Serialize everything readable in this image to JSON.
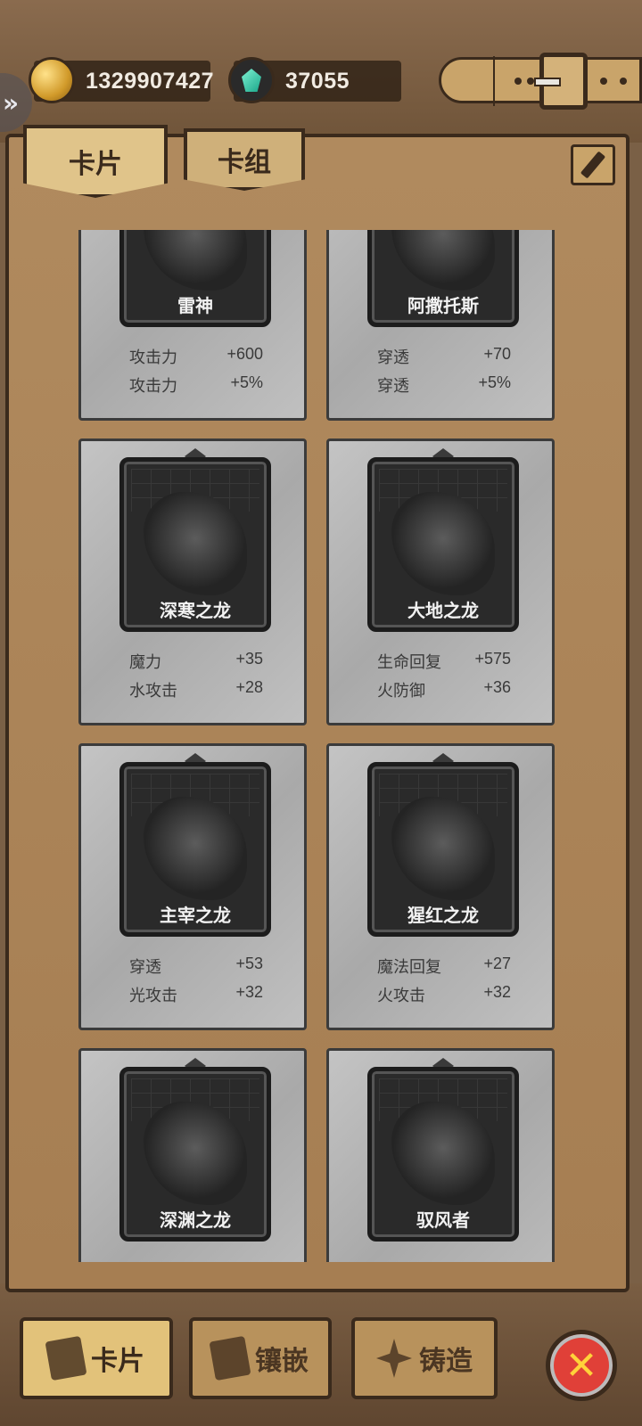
{
  "resources": {
    "gold": "1329907427",
    "gems": "37055",
    "gold_icon": "gold-ore-icon",
    "gem_icon": "green-gem-icon"
  },
  "tabs": [
    {
      "label": "卡片",
      "active": true
    },
    {
      "label": "卡组",
      "active": false
    }
  ],
  "cards": [
    {
      "name": "雷神",
      "stats": [
        {
          "label": "攻击力",
          "value": "+600"
        },
        {
          "label": "攻击力",
          "value": "+5%"
        }
      ]
    },
    {
      "name": "阿撒托斯",
      "stats": [
        {
          "label": "穿透",
          "value": "+70"
        },
        {
          "label": "穿透",
          "value": "+5%"
        }
      ]
    },
    {
      "name": "深寒之龙",
      "stats": [
        {
          "label": "魔力",
          "value": "+35"
        },
        {
          "label": "水攻击",
          "value": "+28"
        }
      ]
    },
    {
      "name": "大地之龙",
      "stats": [
        {
          "label": "生命回复",
          "value": "+575"
        },
        {
          "label": "火防御",
          "value": "+36"
        }
      ]
    },
    {
      "name": "主宰之龙",
      "stats": [
        {
          "label": "穿透",
          "value": "+53"
        },
        {
          "label": "光攻击",
          "value": "+32"
        }
      ]
    },
    {
      "name": "猩红之龙",
      "stats": [
        {
          "label": "魔法回复",
          "value": "+27"
        },
        {
          "label": "火攻击",
          "value": "+32"
        }
      ]
    },
    {
      "name": "深渊之龙",
      "stats": [
        {
          "label": "",
          "value": ""
        },
        {
          "label": "",
          "value": ""
        }
      ]
    },
    {
      "name": "驭风者",
      "stats": [
        {
          "label": "",
          "value": ""
        },
        {
          "label": "",
          "value": ""
        }
      ]
    }
  ],
  "bottom_nav": [
    {
      "label": "卡片",
      "icon": "cards-icon",
      "active": true
    },
    {
      "label": "镶嵌",
      "icon": "book-icon",
      "active": false
    },
    {
      "label": "铸造",
      "icon": "cross-forge-icon",
      "active": false
    }
  ],
  "close_icon": "close-x-icon"
}
